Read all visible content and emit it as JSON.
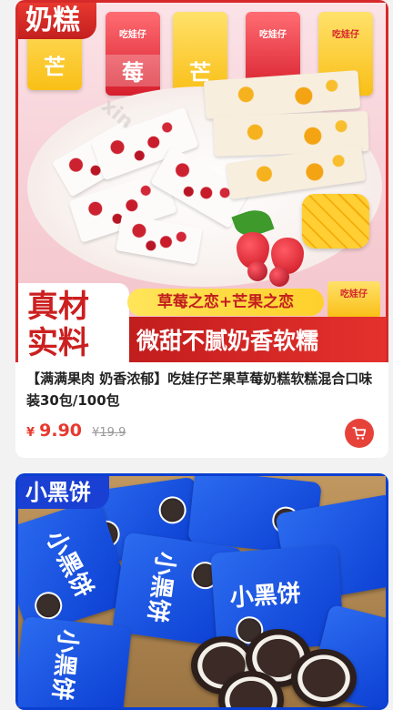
{
  "products": [
    {
      "image_tag": "奶糕",
      "package_brand": "吃娃仔",
      "package_label_mango": "芒",
      "package_label_berry": "莓",
      "badge_real": "真材实料",
      "badge_real_line1": "真材",
      "badge_real_line2": "实料",
      "flavor_banner": "草莓之恋+芒果之恋",
      "slogan": "微甜不腻奶香软糯",
      "title": "【满满果肉 奶香浓郁】吃娃仔芒果草莓奶糕软糕混合口味装30包/100包",
      "currency": "¥",
      "price": "9.90",
      "original_price": "¥19.9",
      "cart_icon": "cart-icon"
    },
    {
      "image_tag": "小黑饼",
      "bag_label": "小黑饼"
    }
  ],
  "colors": {
    "price_red": "#e8392f",
    "tag1_red": "#d62a2a",
    "tag2_blue": "#1a3fd3"
  }
}
